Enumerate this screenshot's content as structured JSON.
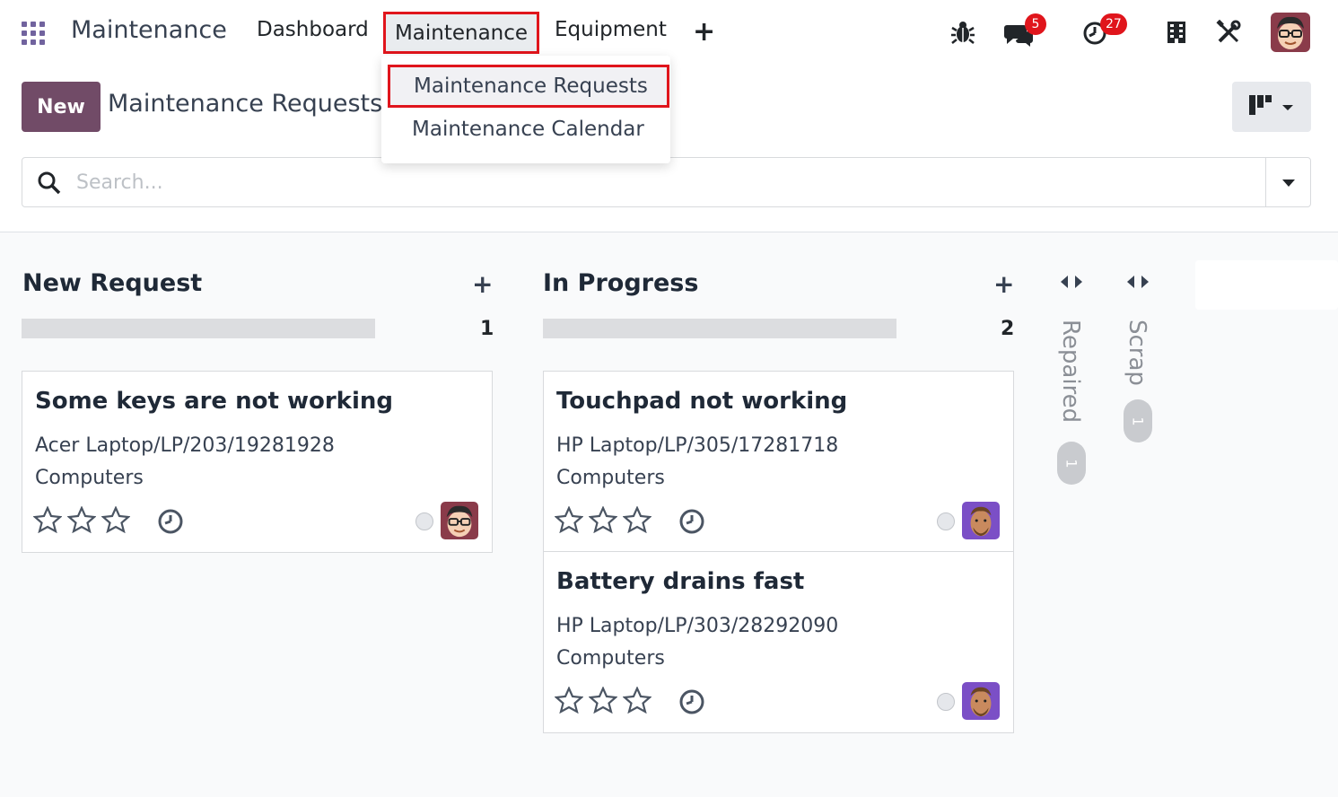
{
  "navbar": {
    "brand": "Maintenance",
    "menu": {
      "dashboard": "Dashboard",
      "maintenance": "Maintenance",
      "equipment": "Equipment",
      "add": "+"
    },
    "messages_count": "5",
    "activities_count": "27"
  },
  "dropdown": {
    "items": [
      "Maintenance Requests",
      "Maintenance Calendar"
    ]
  },
  "control": {
    "new_label": "New",
    "title": "Maintenance Requests",
    "search_placeholder": "Search..."
  },
  "columns": [
    {
      "title": "New Request",
      "count": "1",
      "cards": [
        {
          "title": "Some keys are not working",
          "equipment": "Acer Laptop/LP/203/19281928",
          "category": "Computers"
        }
      ]
    },
    {
      "title": "In Progress",
      "count": "2",
      "cards": [
        {
          "title": "Touchpad not working",
          "equipment": "HP Laptop/LP/305/17281718",
          "category": "Computers"
        },
        {
          "title": "Battery drains fast",
          "equipment": "HP Laptop/LP/303/28292090",
          "category": "Computers"
        }
      ]
    }
  ],
  "folded_columns": [
    {
      "title": "Repaired",
      "count": "1"
    },
    {
      "title": "Scrap",
      "count": "1"
    }
  ],
  "colors": {
    "accent": "#714b67",
    "highlight": "#e0151c",
    "badge": "#e0151c"
  }
}
